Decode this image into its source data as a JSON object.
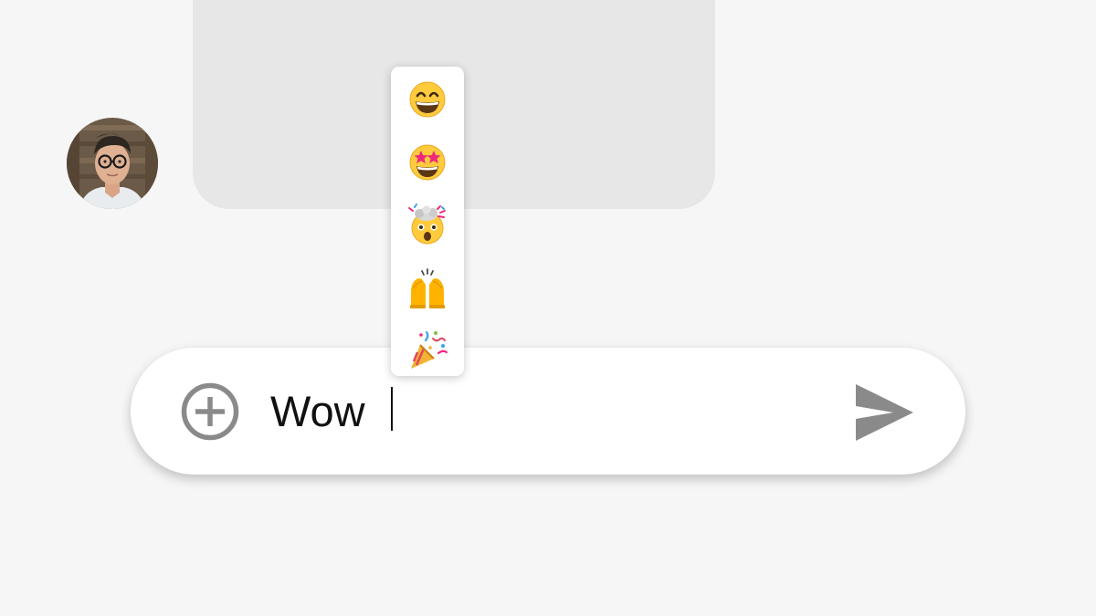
{
  "composer": {
    "input_value": "Wow "
  },
  "emoji_picker": {
    "options": [
      {
        "name": "grinning-face-with-smiling-eyes",
        "char": "😄"
      },
      {
        "name": "star-struck",
        "char": "🤩"
      },
      {
        "name": "exploding-head",
        "char": "🤯"
      },
      {
        "name": "raising-hands",
        "char": "🙌"
      },
      {
        "name": "party-popper",
        "char": "🎉"
      }
    ]
  },
  "icons": {
    "add": "plus-circle-icon",
    "send": "send-icon"
  },
  "colors": {
    "background": "#f6f6f6",
    "bubble": "#e7e7e7",
    "icon_gray": "#8a8a8a",
    "emoji_yellow": "#ffcb3d"
  }
}
